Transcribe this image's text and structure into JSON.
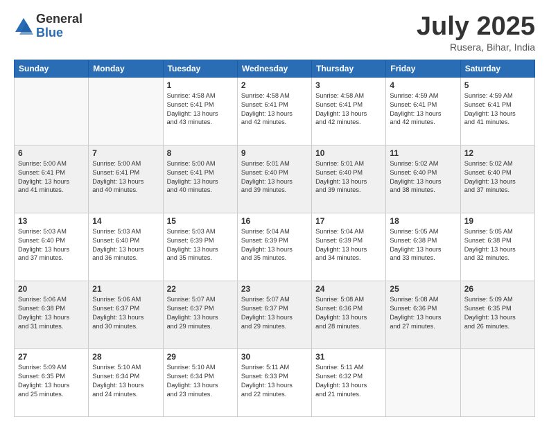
{
  "logo": {
    "general": "General",
    "blue": "Blue"
  },
  "title": "July 2025",
  "location": "Rusera, Bihar, India",
  "headers": [
    "Sunday",
    "Monday",
    "Tuesday",
    "Wednesday",
    "Thursday",
    "Friday",
    "Saturday"
  ],
  "weeks": [
    [
      {
        "day": "",
        "info": ""
      },
      {
        "day": "",
        "info": ""
      },
      {
        "day": "1",
        "info": "Sunrise: 4:58 AM\nSunset: 6:41 PM\nDaylight: 13 hours\nand 43 minutes."
      },
      {
        "day": "2",
        "info": "Sunrise: 4:58 AM\nSunset: 6:41 PM\nDaylight: 13 hours\nand 42 minutes."
      },
      {
        "day": "3",
        "info": "Sunrise: 4:58 AM\nSunset: 6:41 PM\nDaylight: 13 hours\nand 42 minutes."
      },
      {
        "day": "4",
        "info": "Sunrise: 4:59 AM\nSunset: 6:41 PM\nDaylight: 13 hours\nand 42 minutes."
      },
      {
        "day": "5",
        "info": "Sunrise: 4:59 AM\nSunset: 6:41 PM\nDaylight: 13 hours\nand 41 minutes."
      }
    ],
    [
      {
        "day": "6",
        "info": "Sunrise: 5:00 AM\nSunset: 6:41 PM\nDaylight: 13 hours\nand 41 minutes."
      },
      {
        "day": "7",
        "info": "Sunrise: 5:00 AM\nSunset: 6:41 PM\nDaylight: 13 hours\nand 40 minutes."
      },
      {
        "day": "8",
        "info": "Sunrise: 5:00 AM\nSunset: 6:41 PM\nDaylight: 13 hours\nand 40 minutes."
      },
      {
        "day": "9",
        "info": "Sunrise: 5:01 AM\nSunset: 6:40 PM\nDaylight: 13 hours\nand 39 minutes."
      },
      {
        "day": "10",
        "info": "Sunrise: 5:01 AM\nSunset: 6:40 PM\nDaylight: 13 hours\nand 39 minutes."
      },
      {
        "day": "11",
        "info": "Sunrise: 5:02 AM\nSunset: 6:40 PM\nDaylight: 13 hours\nand 38 minutes."
      },
      {
        "day": "12",
        "info": "Sunrise: 5:02 AM\nSunset: 6:40 PM\nDaylight: 13 hours\nand 37 minutes."
      }
    ],
    [
      {
        "day": "13",
        "info": "Sunrise: 5:03 AM\nSunset: 6:40 PM\nDaylight: 13 hours\nand 37 minutes."
      },
      {
        "day": "14",
        "info": "Sunrise: 5:03 AM\nSunset: 6:40 PM\nDaylight: 13 hours\nand 36 minutes."
      },
      {
        "day": "15",
        "info": "Sunrise: 5:03 AM\nSunset: 6:39 PM\nDaylight: 13 hours\nand 35 minutes."
      },
      {
        "day": "16",
        "info": "Sunrise: 5:04 AM\nSunset: 6:39 PM\nDaylight: 13 hours\nand 35 minutes."
      },
      {
        "day": "17",
        "info": "Sunrise: 5:04 AM\nSunset: 6:39 PM\nDaylight: 13 hours\nand 34 minutes."
      },
      {
        "day": "18",
        "info": "Sunrise: 5:05 AM\nSunset: 6:38 PM\nDaylight: 13 hours\nand 33 minutes."
      },
      {
        "day": "19",
        "info": "Sunrise: 5:05 AM\nSunset: 6:38 PM\nDaylight: 13 hours\nand 32 minutes."
      }
    ],
    [
      {
        "day": "20",
        "info": "Sunrise: 5:06 AM\nSunset: 6:38 PM\nDaylight: 13 hours\nand 31 minutes."
      },
      {
        "day": "21",
        "info": "Sunrise: 5:06 AM\nSunset: 6:37 PM\nDaylight: 13 hours\nand 30 minutes."
      },
      {
        "day": "22",
        "info": "Sunrise: 5:07 AM\nSunset: 6:37 PM\nDaylight: 13 hours\nand 29 minutes."
      },
      {
        "day": "23",
        "info": "Sunrise: 5:07 AM\nSunset: 6:37 PM\nDaylight: 13 hours\nand 29 minutes."
      },
      {
        "day": "24",
        "info": "Sunrise: 5:08 AM\nSunset: 6:36 PM\nDaylight: 13 hours\nand 28 minutes."
      },
      {
        "day": "25",
        "info": "Sunrise: 5:08 AM\nSunset: 6:36 PM\nDaylight: 13 hours\nand 27 minutes."
      },
      {
        "day": "26",
        "info": "Sunrise: 5:09 AM\nSunset: 6:35 PM\nDaylight: 13 hours\nand 26 minutes."
      }
    ],
    [
      {
        "day": "27",
        "info": "Sunrise: 5:09 AM\nSunset: 6:35 PM\nDaylight: 13 hours\nand 25 minutes."
      },
      {
        "day": "28",
        "info": "Sunrise: 5:10 AM\nSunset: 6:34 PM\nDaylight: 13 hours\nand 24 minutes."
      },
      {
        "day": "29",
        "info": "Sunrise: 5:10 AM\nSunset: 6:34 PM\nDaylight: 13 hours\nand 23 minutes."
      },
      {
        "day": "30",
        "info": "Sunrise: 5:11 AM\nSunset: 6:33 PM\nDaylight: 13 hours\nand 22 minutes."
      },
      {
        "day": "31",
        "info": "Sunrise: 5:11 AM\nSunset: 6:32 PM\nDaylight: 13 hours\nand 21 minutes."
      },
      {
        "day": "",
        "info": ""
      },
      {
        "day": "",
        "info": ""
      }
    ]
  ]
}
